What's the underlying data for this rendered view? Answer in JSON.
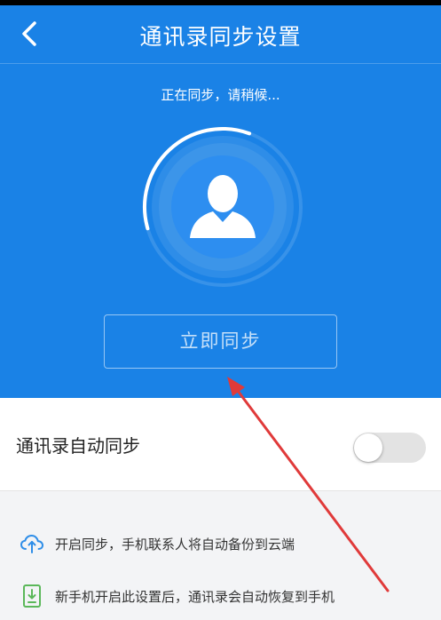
{
  "header": {
    "title": "通讯录同步设置",
    "back_icon": "chevron-left-icon"
  },
  "sync": {
    "status_text": "正在同步，请稍候...",
    "avatar_icon": "person-icon",
    "button_label": "立即同步",
    "progress_percent": 35
  },
  "auto_sync": {
    "label": "通讯录自动同步",
    "enabled": false
  },
  "tips": [
    {
      "icon": "cloud-upload-icon",
      "text": "开启同步，手机联系人将自动备份到云端"
    },
    {
      "icon": "phone-download-icon",
      "text": "新手机开启此设置后，通讯录会自动恢复到手机"
    }
  ],
  "colors": {
    "primary_blue": "#1a82e6",
    "annotation_arrow": "#e03a3a",
    "tip_icon_blue": "#2f8ee8",
    "tip_icon_green": "#5bb85a"
  }
}
